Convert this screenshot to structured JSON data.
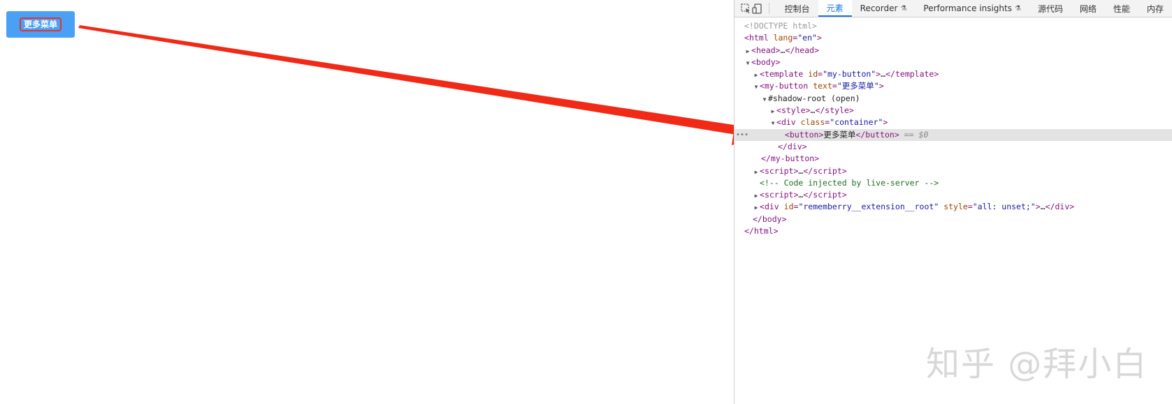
{
  "page": {
    "button_label": "更多菜单"
  },
  "devtools": {
    "tabs": [
      "控制台",
      "元素",
      "Recorder",
      "Performance insights",
      "源代码",
      "网络",
      "性能",
      "内存"
    ],
    "active_tab": "元素",
    "dom": {
      "doctype": "<!DOCTYPE html>",
      "html_tag": "html",
      "html_attr": "lang",
      "html_attr_val": "\"en\"",
      "head": "head",
      "ellipsis": "…",
      "body": "body",
      "template_tag": "template",
      "id_attr": "id",
      "template_id": "\"my-button\"",
      "my_button_tag": "my-button",
      "text_attr": "text",
      "my_button_text": "\"更多菜单\"",
      "shadow_root": "#shadow-root (open)",
      "style_tag": "style",
      "div_tag": "div",
      "class_attr": "class",
      "div_class": "\"container\"",
      "button_tag": "button",
      "button_text": "更多菜单",
      "selected_marker": "== $0",
      "script_tag": "script",
      "comment": "<!-- Code injected by live-server -->",
      "ext_id": "\"rememberry__extension__root\"",
      "style_attr": "style",
      "ext_style": "\"all: unset;\""
    }
  },
  "colors": {
    "button_bg": "#4aa0f4",
    "arrow": "#f02a17",
    "highlight_border": "#e6322a",
    "active_tab": "#1a73e8"
  },
  "watermark": "知乎 @拜小白"
}
